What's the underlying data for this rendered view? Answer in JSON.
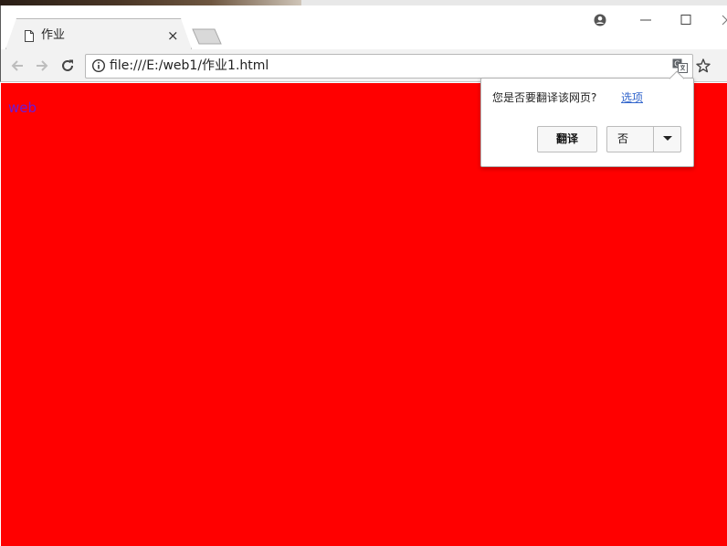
{
  "browser": {
    "tab": {
      "title": "作业",
      "close_icon": "×"
    },
    "address_bar": {
      "url": "file:///E:/web1/作业1.html"
    },
    "window_controls": {
      "profile": "profile-icon",
      "minimize": "—",
      "maximize": "☐"
    }
  },
  "page": {
    "background_color": "#ff0000",
    "text": "web",
    "text_color": "#6a1bd8"
  },
  "translate_bubble": {
    "question": "您是否要翻译该网页?",
    "options_link": "选项",
    "translate_button": "翻译",
    "no_button": "否"
  }
}
